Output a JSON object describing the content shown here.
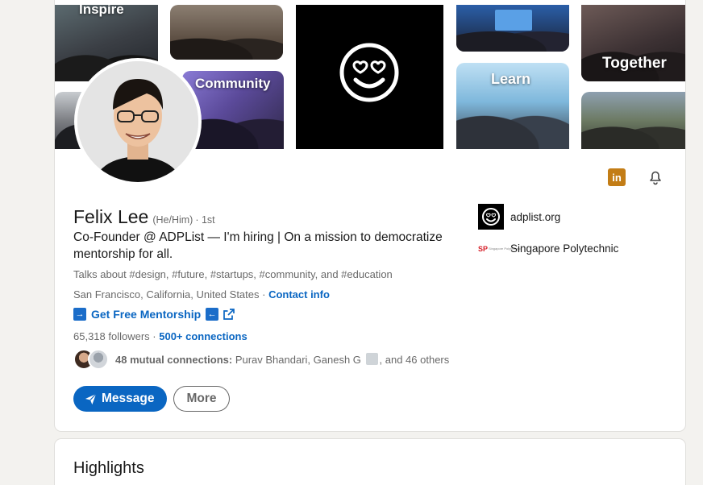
{
  "banner": {
    "tiles": [
      {
        "label": "Inspire"
      },
      {
        "label": ""
      },
      {
        "label": ""
      },
      {
        "label": "Community"
      },
      {
        "label": ""
      },
      {
        "label": ""
      },
      {
        "label": "Learn"
      },
      {
        "label": "Together"
      },
      {
        "label": ""
      }
    ]
  },
  "profile": {
    "name": "Felix Lee",
    "pronouns": "(He/Him)",
    "degree": "· 1st",
    "headline": "Co-Founder @ ADPList — I'm hiring | On a mission to democratize mentorship for all.",
    "talks_about": "Talks about #design, #future, #startups, #community, and #education",
    "location": "San Francisco, California, United States",
    "location_sep": " · ",
    "contact_label": "Contact info",
    "mentorship_label": "Get Free Mentorship",
    "followers": "65,318 followers",
    "followers_sep": " · ",
    "connections": "500+ connections",
    "mutual_prefix": "48 mutual connections:",
    "mutual_names": " Purav Bhandari, Ganesh G",
    "mutual_suffix": ", and 46 others"
  },
  "actions": {
    "message_label": "Message",
    "more_label": "More"
  },
  "side": {
    "company": "adplist.org",
    "school": "Singapore Polytechnic",
    "school_logo_text": "SP",
    "school_logo_tiny": "Singapore Polytechnic"
  },
  "icons": {
    "linkedin": "in",
    "arrow_left": "←",
    "arrow_right": "→"
  },
  "highlights": {
    "title": "Highlights"
  },
  "colors": {
    "link_blue": "#0a66c2",
    "badge_gold": "#c37d16",
    "page_bg": "#f3f2ef"
  }
}
